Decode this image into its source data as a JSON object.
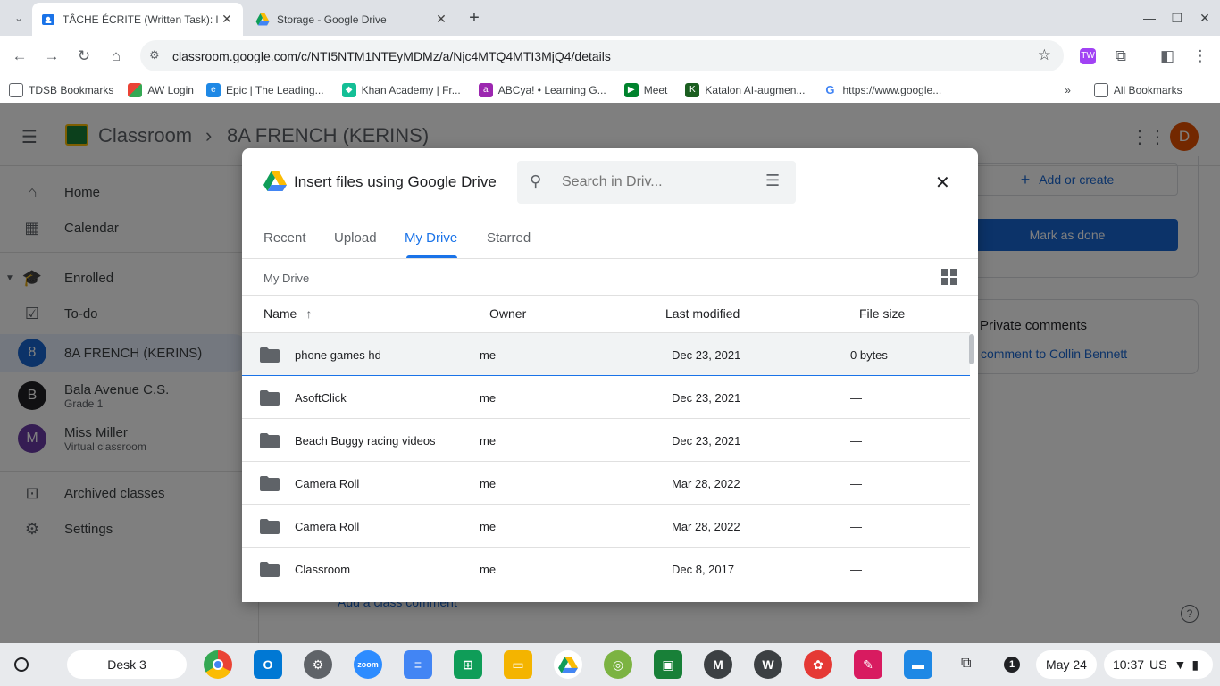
{
  "browser": {
    "tabs": [
      {
        "title": "TÂCHE ÉCRITE (Written Task): l",
        "active": true
      },
      {
        "title": "Storage - Google Drive",
        "active": false
      }
    ],
    "url": "classroom.google.com/c/NTI5NTM1NTEyMDMz/a/Njc4MTQ4MTI3MjQ4/details",
    "bookmarks": [
      "TDSB Bookmarks",
      "AW Login",
      "Epic | The Leading...",
      "Khan Academy | Fr...",
      "ABCya! • Learning G...",
      "Meet",
      "Katalon AI-augmen...",
      "https://www.google...",
      "All Bookmarks"
    ]
  },
  "classroom": {
    "app_name": "Classroom",
    "class_name": "8A FRENCH (KERINS)",
    "avatar_letter": "D",
    "nav": {
      "home": "Home",
      "calendar": "Calendar",
      "enrolled": "Enrolled",
      "todo": "To-do",
      "archived": "Archived classes",
      "settings": "Settings"
    },
    "classes": [
      {
        "initial": "8",
        "name": "8A FRENCH (KERINS)",
        "sub": "",
        "color": "#1967d2"
      },
      {
        "initial": "B",
        "name": "Bala Avenue C.S.",
        "sub": "Grade 1",
        "color": "#202124"
      },
      {
        "initial": "M",
        "name": "Miss Miller",
        "sub": "Virtual classroom",
        "color": "#6a3aa6"
      }
    ],
    "add_or_create": "Add or create",
    "mark_as_done": "Mark as done",
    "private_comments": "Private comments",
    "private_comment_link": "l comment to Collin Bennett",
    "class_comment": "Add a class comment"
  },
  "dialog": {
    "title": "Insert files using Google Drive",
    "search_placeholder": "Search in Driv...",
    "tabs": [
      "Recent",
      "Upload",
      "My Drive",
      "Starred"
    ],
    "selected_tab": "My Drive",
    "breadcrumb": "My Drive",
    "columns": {
      "name": "Name",
      "owner": "Owner",
      "modified": "Last modified",
      "size": "File size"
    },
    "rows": [
      {
        "name": "phone games hd",
        "owner": "me",
        "modified": "Dec 23, 2021",
        "size": "0 bytes"
      },
      {
        "name": "AsoftClick",
        "owner": "me",
        "modified": "Dec 23, 2021",
        "size": "—"
      },
      {
        "name": "Beach Buggy racing videos",
        "owner": "me",
        "modified": "Dec 23, 2021",
        "size": "—"
      },
      {
        "name": "Camera Roll",
        "owner": "me",
        "modified": "Mar 28, 2022",
        "size": "—"
      },
      {
        "name": "Camera Roll",
        "owner": "me",
        "modified": "Mar 28, 2022",
        "size": "—"
      },
      {
        "name": "Classroom",
        "owner": "me",
        "modified": "Dec 8, 2017",
        "size": "—"
      }
    ]
  },
  "shelf": {
    "desk": "Desk 3",
    "notification_count": "1",
    "date": "May 24",
    "time": "10:37",
    "locale": "US"
  }
}
